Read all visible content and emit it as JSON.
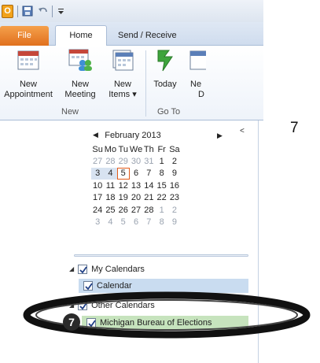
{
  "qat": {
    "app_icon": "O"
  },
  "tabs": {
    "file": "File",
    "home": "Home",
    "send_receive": "Send / Receive"
  },
  "ribbon": {
    "new_appointment": {
      "line1": "New",
      "line2": "Appointment"
    },
    "new_meeting": {
      "line1": "New",
      "line2": "Meeting"
    },
    "new_items": {
      "line1": "New",
      "line2": "Items ▾"
    },
    "today": {
      "line1": "Today"
    },
    "next_days": {
      "line1": "Ne",
      "line2": "D"
    },
    "group_new": "New",
    "group_goto": "Go To"
  },
  "calendar": {
    "month_title": "February 2013",
    "prev": "◀",
    "next": "▶",
    "weekdays": [
      "Su",
      "Mo",
      "Tu",
      "We",
      "Th",
      "Fr",
      "Sa"
    ],
    "weeks": [
      [
        "27",
        "28",
        "29",
        "30",
        "31",
        "1",
        "2"
      ],
      [
        "3",
        "4",
        "5",
        "6",
        "7",
        "8",
        "9"
      ],
      [
        "10",
        "11",
        "12",
        "13",
        "14",
        "15",
        "16"
      ],
      [
        "17",
        "18",
        "19",
        "20",
        "21",
        "22",
        "23"
      ],
      [
        "24",
        "25",
        "26",
        "27",
        "28",
        "1",
        "2"
      ],
      [
        "3",
        "4",
        "5",
        "6",
        "7",
        "8",
        "9"
      ]
    ]
  },
  "nav": {
    "collapse": "<",
    "my_calendars": "My Calendars",
    "calendar": "Calendar",
    "other_calendars": "Other Calendars",
    "michigan": "Michigan Bureau of Elections"
  },
  "annotation": {
    "step_number": "7",
    "side_number": "7"
  },
  "colors": {
    "accent_orange": "#e0701e",
    "selection_blue": "#c9dcf0",
    "highlight_green": "#c6e3bd",
    "today_outline": "#e35b1a"
  }
}
